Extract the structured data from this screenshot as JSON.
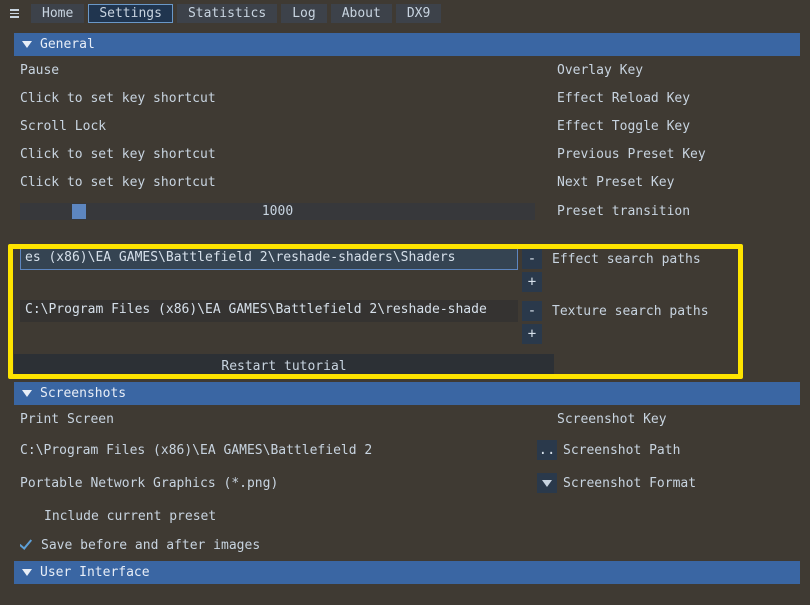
{
  "tabs": [
    "Home",
    "Settings",
    "Statistics",
    "Log",
    "About",
    "DX9"
  ],
  "active_tab": 1,
  "sections": {
    "general": "General",
    "screenshots": "Screenshots",
    "ui": "User Interface"
  },
  "general": {
    "pause_value": "Pause",
    "overlay_key": "Overlay Key",
    "r1_value": "Click to set key shortcut",
    "effect_reload_key": "Effect Reload Key",
    "r2_value": "Scroll Lock",
    "effect_toggle_key": "Effect Toggle Key",
    "r3_value": "Click to set key shortcut",
    "previous_preset_key": "Previous Preset Key",
    "r4_value": "Click to set key shortcut",
    "next_preset_key": "Next Preset Key",
    "transition_value": "1000",
    "preset_transition": "Preset transition",
    "effect_paths_value": "es (x86)\\EA GAMES\\Battlefield 2\\reshade-shaders\\Shaders",
    "effect_paths_label": "Effect search paths",
    "texture_paths_value": "C:\\Program Files (x86)\\EA GAMES\\Battlefield 2\\reshade-shade",
    "texture_paths_label": "Texture search paths",
    "restart_tutorial": "Restart tutorial"
  },
  "screenshots": {
    "key_value": "Print Screen",
    "key_label": "Screenshot Key",
    "path_value": "C:\\Program Files (x86)\\EA GAMES\\Battlefield 2",
    "path_browse": "..",
    "path_label": "Screenshot Path",
    "fmt_value": "Portable Network Graphics (*.png)",
    "fmt_label": "Screenshot Format",
    "include_preset": "Include current preset",
    "save_ba": "Save before and after images"
  },
  "glyph": {
    "minus": "-",
    "plus": "+"
  }
}
